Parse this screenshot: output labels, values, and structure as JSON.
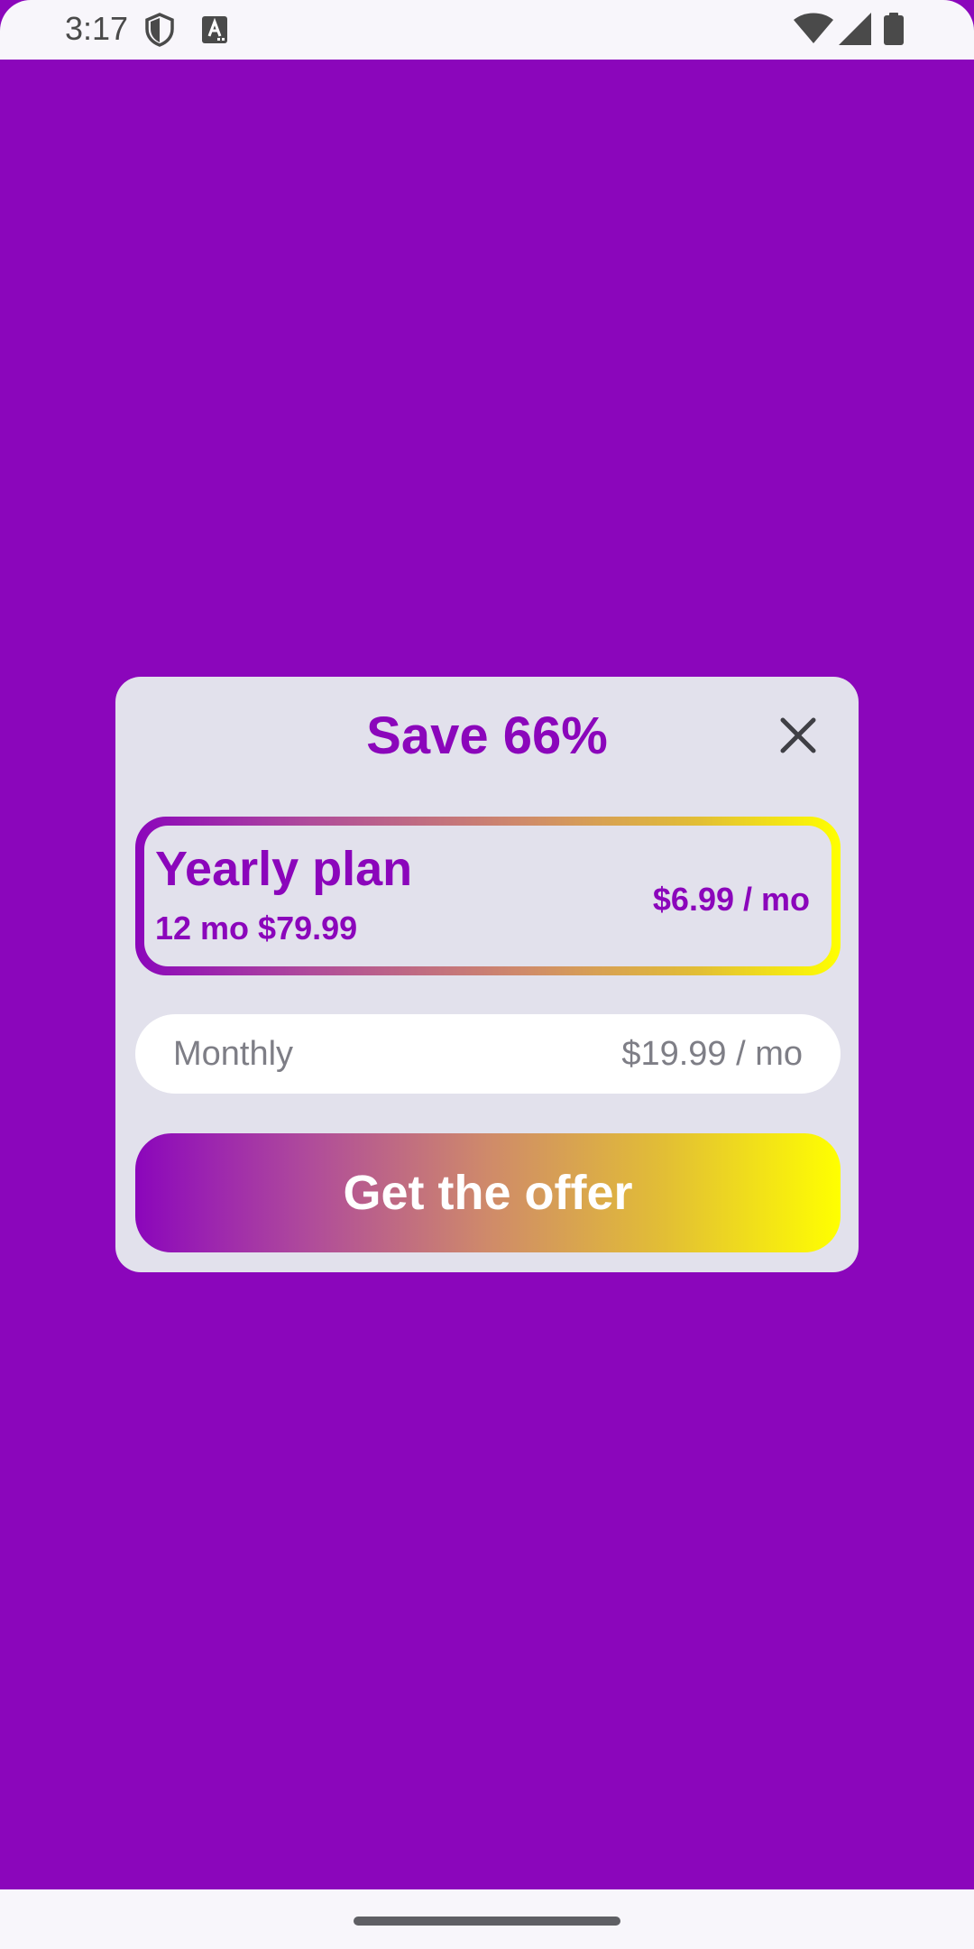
{
  "status_bar": {
    "time": "3:17",
    "icons": [
      "shield-icon",
      "text-a-icon",
      "wifi-icon",
      "signal-icon",
      "battery-icon"
    ]
  },
  "dialog": {
    "title": "Save 66%",
    "close_icon": "close-icon",
    "yearly_plan": {
      "title": "Yearly plan",
      "subtitle": "12 mo $79.99",
      "price": "$6.99 / mo",
      "selected": true
    },
    "monthly_plan": {
      "label": "Monthly",
      "price": "$19.99 / mo",
      "selected": false
    },
    "cta_label": "Get the offer"
  },
  "colors": {
    "background": "#8b06bb",
    "accent": "#8b06bb",
    "gradient_end": "#ffff00",
    "dialog_bg": "#e2e1ec"
  }
}
